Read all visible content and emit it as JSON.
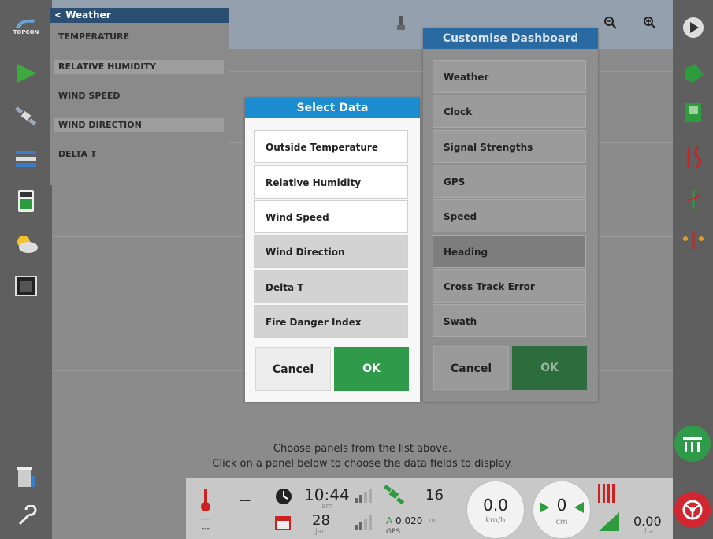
{
  "weather_panel": {
    "back_label": "< Weather",
    "rows": [
      "TEMPERATURE",
      "RELATIVE HUMIDITY",
      "WIND SPEED",
      "WIND DIRECTION",
      "DELTA T"
    ]
  },
  "select_data": {
    "title": "Select Data",
    "items": [
      "Outside Temperature",
      "Relative Humidity",
      "Wind Speed",
      "Wind Direction",
      "Delta T",
      "Fire Danger Index"
    ],
    "cancel": "Cancel",
    "ok": "OK"
  },
  "customise": {
    "title": "Customise Dashboard",
    "items": [
      "Weather",
      "Clock",
      "Signal Strengths",
      "GPS",
      "Speed",
      "Heading",
      "Cross Track Error",
      "Swath"
    ],
    "cancel": "Cancel",
    "ok": "OK"
  },
  "hint": {
    "line1": "Choose panels from the list above.",
    "line2": "Click on a panel below to choose the data fields to display."
  },
  "dashboard": {
    "temp_value": "---",
    "temp_sub1": "---",
    "temp_sub2": "---",
    "clock_time": "10:44",
    "clock_ampm": "am",
    "date_day": "28",
    "date_month": "Jan",
    "sat_count": "16",
    "gps_accuracy": "0.020",
    "gps_unit": "m",
    "gps_label": "GPS",
    "speed_value": "0.0",
    "speed_unit": "km/h",
    "xte_value": "0",
    "xte_unit": "cm",
    "area_top": "---",
    "area_value": "0.00",
    "area_unit": "ha"
  },
  "logo_text": "TOPCON",
  "icons": {
    "left": [
      "topcon-logo-icon",
      "guidance-arrow-icon",
      "satellite-icon",
      "layers-icon",
      "console-icon",
      "weather-icon",
      "screen-icon",
      "trash-bin-icon",
      "wrench-icon"
    ],
    "right": [
      "play-icon",
      "field-icon",
      "map-document-icon",
      "tracks-icon",
      "tractor-icon",
      "implement-icon",
      "sections-auto-icon",
      "steering-icon"
    ],
    "toolbar": [
      "hand-icon",
      "view-icon",
      "compass-icon",
      "diamond-icon",
      "screenshot-icon",
      "zoom-out-icon",
      "zoom-in-icon"
    ]
  },
  "colors": {
    "dialog_title": "#1a8ccf",
    "ok_button": "#2f9a4a",
    "steering": "#d22630"
  }
}
